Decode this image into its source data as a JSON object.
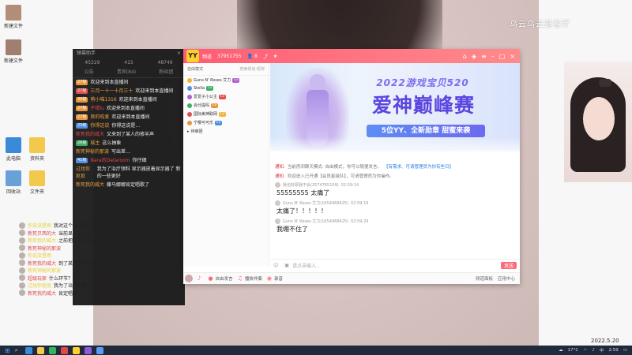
{
  "background": {
    "watermark": "乌云乌云逛客厅",
    "corner_stamp": "2022.5.20"
  },
  "desktop_icons": [
    {
      "label": "新建文件",
      "color": "#b08e7a"
    },
    {
      "label": "新建文件",
      "color": "#a07f70"
    },
    {
      "label": "此电脑",
      "color": "#3b8ad9"
    },
    {
      "label": "资料夹",
      "color": "#f2c94c"
    },
    {
      "label": "回收站",
      "color": "#6aa0d8"
    },
    {
      "label": "文件夹",
      "color": "#f2c94c"
    }
  ],
  "chat_panel": {
    "title": "弹幕助手",
    "close": "×",
    "stats": [
      "45329",
      "415",
      "48749"
    ],
    "tabs": [
      "公告",
      "贵宾(84)",
      "粉丝团"
    ],
    "messages": [
      {
        "badge": "27级",
        "badge_color": "b-o",
        "name": "",
        "text": "欢迎来到本直播间"
      },
      {
        "badge": "27级",
        "badge_color": "b-r",
        "name": "三月一十一十月三十",
        "text": "欢迎来到本直播间"
      },
      {
        "badge": "30级",
        "badge_color": "b-o",
        "name": "萌小喵1316",
        "text": "欢迎来到本直播间"
      },
      {
        "badge": "27级",
        "badge_color": "b-o",
        "name": "子楼lu",
        "text": "欢迎来到本直播间"
      },
      {
        "badge": "27级",
        "badge_color": "b-o",
        "name": "爽的啦爱",
        "text": "欢迎来到本直播间"
      },
      {
        "badge": "23级",
        "badge_color": "b-b",
        "name": "你得这说",
        "text": "你得这说是…"
      },
      {
        "badge": "",
        "badge_color": "",
        "name": "新死我的威大",
        "text": "又来到了某人的修羊声"
      },
      {
        "badge": "26级",
        "badge_color": "b-g",
        "name": "城主",
        "text": "这么抽象"
      },
      {
        "badge": "",
        "badge_color": "",
        "name": "新死神秘的那波",
        "text": "写出差…"
      },
      {
        "badge": "41级",
        "badge_color": "b-b",
        "name": "Nara的Dataroom",
        "text": "你仔细"
      },
      {
        "badge": "",
        "badge_color": "",
        "name": "过找你抠抠",
        "text": "我为了治疗领料  显示器放着显示器了 新的一些更好"
      },
      {
        "badge": "",
        "badge_color": "",
        "name": "新死我的威大",
        "text": "藤马娜娜肯定唱歌了"
      }
    ]
  },
  "overlay_chat": [
    {
      "name": "你说流星雨",
      "text": "我对这个直播特别喜欢 (*°▽°*)"
    },
    {
      "name": "新死贝西的大",
      "text": "当前显示对付的乐趣、遥控、意致开通"
    },
    {
      "name": "新死我的威大",
      "text": "之前把最好设置小礼物屏蔽"
    },
    {
      "name": "新死神秘的那波",
      "text": ""
    },
    {
      "name": "你说流星雨",
      "text": ""
    },
    {
      "name": "新死我的威大",
      "text": "到了某人的手抖声"
    },
    {
      "name": "新死神秘的那波",
      "text": ""
    },
    {
      "name": "超级玩家",
      "text": "什么环节？"
    },
    {
      "name": "过找你抠抠",
      "text": "我为了治疗领料  显示器放着显示器了 新的一些"
    },
    {
      "name": "新死我的威大",
      "text": "肯定唱歌了"
    }
  ],
  "window": {
    "logo": "YY",
    "tab": "频道",
    "channel_id": "37951755",
    "online": "8",
    "left_panel": {
      "mode": "自由模式",
      "search_placeholder": "搜索频道·昵称",
      "users": [
        {
          "name": "Guns N' Roses 艾力",
          "level": "Lv"
        },
        {
          "name": "Stella",
          "level": "Lv"
        },
        {
          "name": "爱爱子小公主",
          "level": "Lv"
        },
        {
          "name": "会分提吗",
          "level": "Lv"
        },
        {
          "name": "国际美神联网",
          "level": "Lv"
        },
        {
          "name": "宁樱可可乐",
          "level": "Lv"
        }
      ],
      "group": "待审团"
    },
    "banner": {
      "small_title": "2022游戏宝贝520",
      "big_title": "爱神巅峰赛",
      "subtitle": "5位YY、全新勋章  甜蜜来袭"
    },
    "notices": [
      {
        "prefix": "通知:",
        "text": "当前房间聊天模式: 自由模式，你可以随便发言。",
        "link": "【有需求、可请管理员为你有些日】"
      },
      {
        "prefix": "通知:",
        "text": "欢迎进入已开通【会员星级队】，可请管理员为你操作。",
        "link": ""
      }
    ],
    "messages": [
      {
        "name": "我也好耶我不会(2574765109)",
        "time": "02:59:14",
        "body": "55555555 太痛了"
      },
      {
        "name": "Guns N' Roses 艾力(1654968425)",
        "time": "02:59:16",
        "body": "太痛了！！！！！"
      },
      {
        "name": "Guns N' Roses 艾力(1654968425)",
        "time": "02:59:29",
        "body": "我绷不住了"
      }
    ],
    "input_placeholder": "请点击输入…",
    "send": "发送",
    "bottom_bar": {
      "items": [
        "自由发言",
        "播放伴奏",
        "录音"
      ],
      "right": [
        "频道面板",
        "应用中心"
      ]
    }
  },
  "taskbar": {
    "weather": "17°C",
    "lang": "中",
    "time": "2:59"
  }
}
